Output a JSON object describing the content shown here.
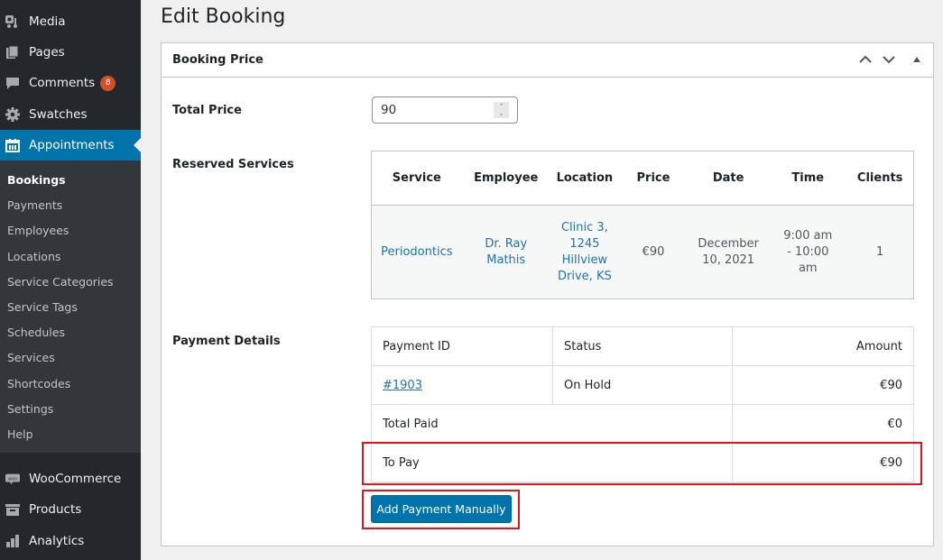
{
  "sidebar": {
    "top_items": [
      {
        "label": "Media",
        "icon": "media-icon"
      },
      {
        "label": "Pages",
        "icon": "pages-icon"
      },
      {
        "label": "Comments",
        "icon": "comments-icon",
        "badge": "8"
      },
      {
        "label": "Swatches",
        "icon": "gear-icon"
      },
      {
        "label": "Appointments",
        "icon": "calendar-icon",
        "active": true
      }
    ],
    "submenu": [
      "Bookings",
      "Payments",
      "Employees",
      "Locations",
      "Service Categories",
      "Service Tags",
      "Schedules",
      "Services",
      "Shortcodes",
      "Settings",
      "Help"
    ],
    "submenu_current": "Bookings",
    "bottom_items": [
      {
        "label": "WooCommerce",
        "icon": "woocommerce-icon"
      },
      {
        "label": "Products",
        "icon": "products-icon"
      },
      {
        "label": "Analytics",
        "icon": "analytics-icon"
      }
    ]
  },
  "page": {
    "title": "Edit Booking"
  },
  "postbox": {
    "title": "Booking Price",
    "total_price_label": "Total Price",
    "total_price_value": "90",
    "reserved_services_label": "Reserved Services",
    "payment_details_label": "Payment Details"
  },
  "services_table": {
    "headers": [
      "Service",
      "Employee",
      "Location",
      "Price",
      "Date",
      "Time",
      "Clients"
    ],
    "rows": [
      {
        "service": "Periodontics",
        "employee": "Dr. Ray Mathis",
        "location": "Clinic 3, 1245 Hillview Drive, KS",
        "price": "€90",
        "date": "December 10, 2021",
        "time": "9:00 am - 10:00 am",
        "clients": "1"
      }
    ]
  },
  "payments_table": {
    "headers": [
      "Payment ID",
      "Status",
      "Amount"
    ],
    "rows": [
      {
        "id": "#1903",
        "status": "On Hold",
        "amount": "€90"
      }
    ],
    "total_paid_label": "Total Paid",
    "total_paid_value": "€0",
    "to_pay_label": "To Pay",
    "to_pay_value": "€90"
  },
  "actions": {
    "add_payment_label": "Add Payment Manually"
  },
  "colors": {
    "accent": "#0073aa",
    "highlight": "#e2151d",
    "badge": "#d54e21",
    "link": "#2271b1"
  }
}
